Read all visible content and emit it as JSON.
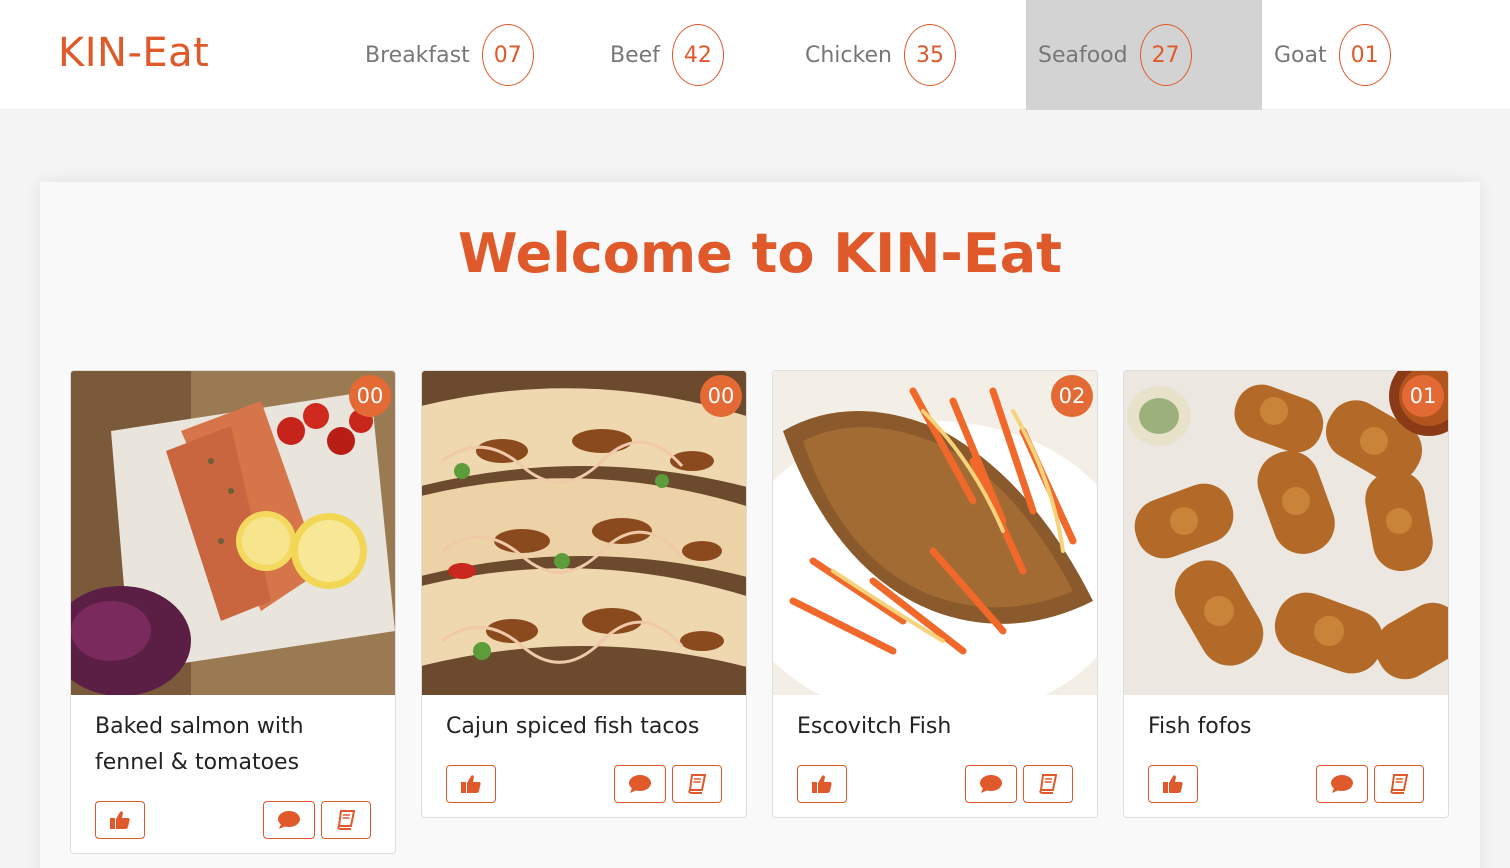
{
  "brand": "KIN-Eat",
  "nav": [
    {
      "label": "Breakfast",
      "count": "07"
    },
    {
      "label": "Beef",
      "count": "42"
    },
    {
      "label": "Chicken",
      "count": "35"
    },
    {
      "label": "Seafood",
      "count": "27"
    },
    {
      "label": "Goat",
      "count": "01"
    }
  ],
  "active_nav": "Seafood",
  "welcome": "Welcome to KIN-Eat",
  "accent_color": "#e0592a",
  "cards": [
    {
      "title": "Baked salmon with fennel & tomatoes",
      "likes": "00"
    },
    {
      "title": "Cajun spiced fish tacos",
      "likes": "00"
    },
    {
      "title": "Escovitch Fish",
      "likes": "02"
    },
    {
      "title": "Fish fofos",
      "likes": "01"
    }
  ],
  "icons": {
    "like": "thumbs-up-icon",
    "comment": "comment-icon",
    "recipe": "book-icon"
  }
}
